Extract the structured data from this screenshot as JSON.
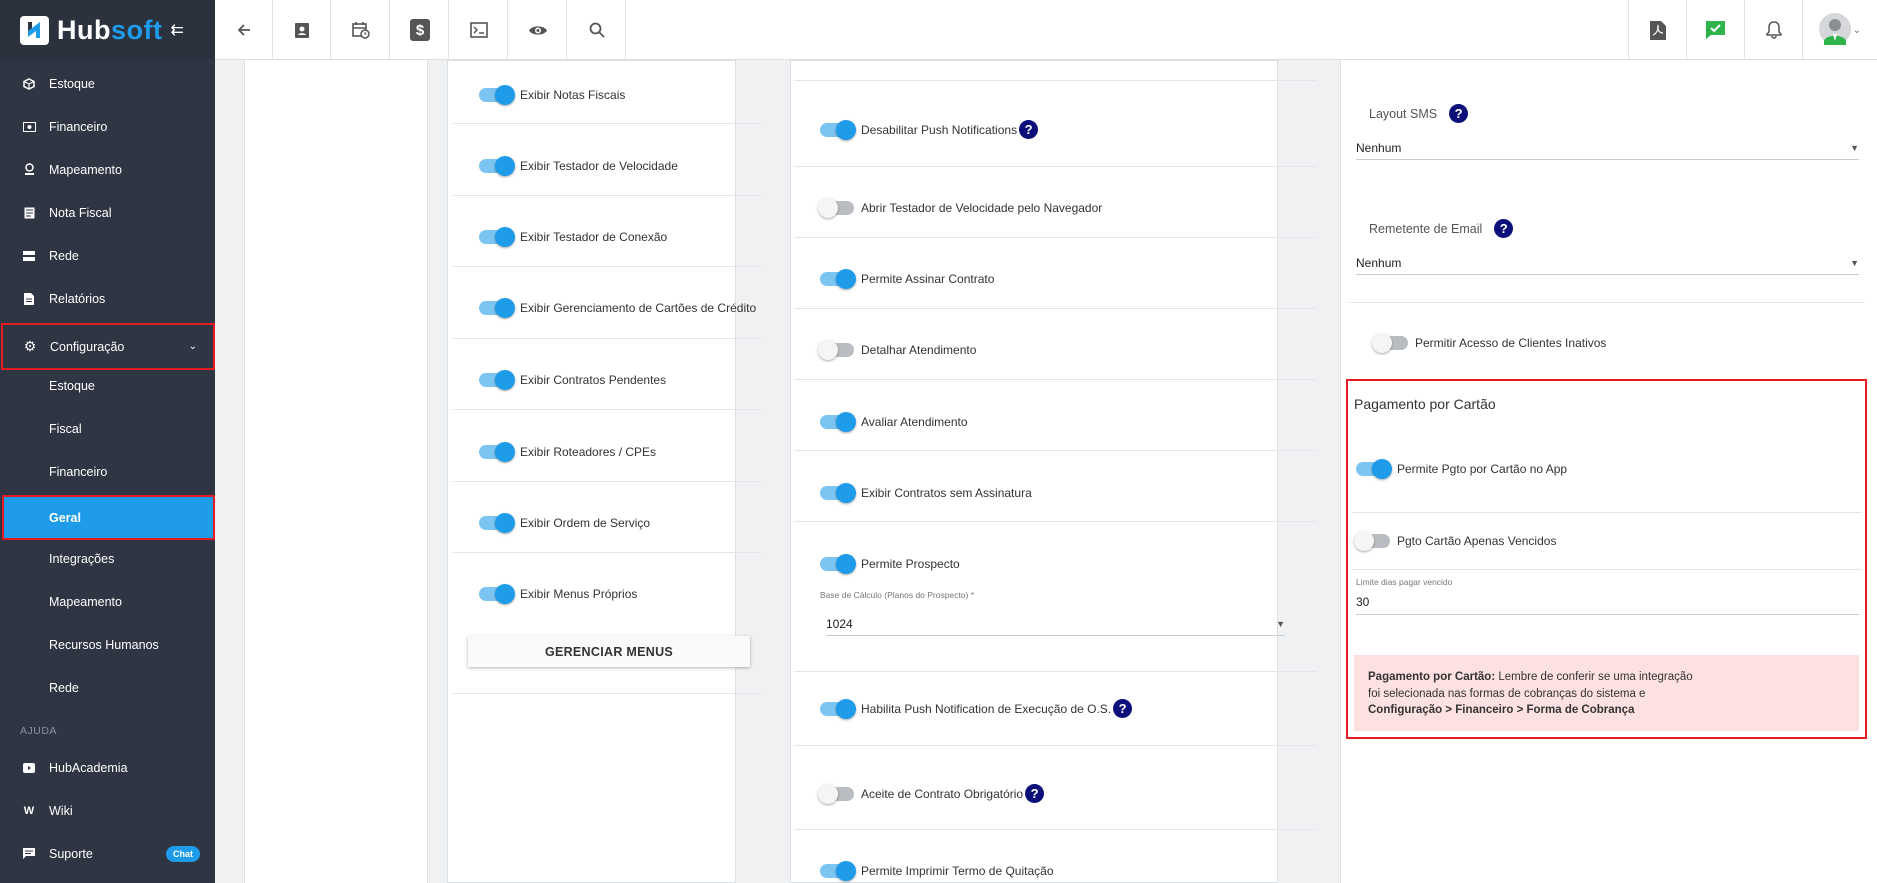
{
  "brand": {
    "name_part1": "Hub",
    "name_part2": "soft"
  },
  "sidebar": {
    "items": [
      {
        "label": "Estoque",
        "icon": "cube-icon"
      },
      {
        "label": "Financeiro",
        "icon": "money-icon"
      },
      {
        "label": "Mapeamento",
        "icon": "map-pin-icon"
      },
      {
        "label": "Nota Fiscal",
        "icon": "receipt-icon"
      },
      {
        "label": "Rede",
        "icon": "server-icon"
      },
      {
        "label": "Relatórios",
        "icon": "document-icon"
      },
      {
        "label": "Configuração",
        "icon": "gear-icon"
      }
    ],
    "sub_items": [
      "Estoque",
      "Fiscal",
      "Financeiro",
      "Geral",
      "Integrações",
      "Mapeamento",
      "Recursos Humanos",
      "Rede"
    ],
    "active_sub": "Geral",
    "help_section": "AJUDA",
    "help_items": [
      {
        "label": "HubAcademia",
        "icon": "youtube-icon"
      },
      {
        "label": "Wiki",
        "icon": "wikipedia-icon"
      },
      {
        "label": "Suporte",
        "icon": "chat-icon",
        "badge": "Chat"
      }
    ]
  },
  "topbar": {
    "left_icons": [
      "back-arrow-icon",
      "contact-card-icon",
      "calendar-clock-icon",
      "dollar-icon",
      "terminal-icon",
      "eye-icon",
      "search-icon"
    ],
    "right_icons": [
      "pdf-icon",
      "chat-check-icon",
      "bell-icon",
      "user-avatar-icon"
    ]
  },
  "col1": {
    "toggles": [
      {
        "label": "Exibir Notas Fiscais",
        "on": true
      },
      {
        "label": "Exibir Testador de Velocidade",
        "on": true
      },
      {
        "label": "Exibir Testador de Conexão",
        "on": true
      },
      {
        "label": "Exibir Gerenciamento de Cartões de Crédito",
        "on": true
      },
      {
        "label": "Exibir Contratos Pendentes",
        "on": true
      },
      {
        "label": "Exibir Roteadores / CPEs",
        "on": true
      },
      {
        "label": "Exibir Ordem de Serviço",
        "on": true
      },
      {
        "label": "Exibir Menus Próprios",
        "on": true
      }
    ],
    "button": "GERENCIAR MENUS"
  },
  "col2": {
    "toggles": [
      {
        "label": "Desabilitar Push Notifications",
        "on": true,
        "help": true
      },
      {
        "label": "Abrir Testador de Velocidade pelo Navegador",
        "on": false
      },
      {
        "label": "Permite Assinar Contrato",
        "on": true
      },
      {
        "label": "Detalhar Atendimento",
        "on": false
      },
      {
        "label": "Avaliar Atendimento",
        "on": true
      },
      {
        "label": "Exibir Contratos sem Assinatura",
        "on": true
      },
      {
        "label": "Permite Prospecto",
        "on": true
      },
      {
        "label": "Habilita Push Notification de Execução de O.S.",
        "on": true,
        "help": true
      },
      {
        "label": "Aceite de Contrato Obrigatório",
        "on": false,
        "help": true
      },
      {
        "label": "Permite Imprimir Termo de Quitação",
        "on": true
      }
    ],
    "base_calculo": {
      "label": "Base de Cálculo (Planos do Prospecto) *",
      "value": "1024"
    }
  },
  "col3": {
    "layout_sms": {
      "label": "Layout SMS",
      "value": "Nenhum"
    },
    "remetente_email": {
      "label": "Remetente de Email",
      "value": "Nenhum"
    },
    "inativos": {
      "label": "Permitir Acesso de Clientes Inativos",
      "on": false
    },
    "card": {
      "title": "Pagamento por Cartão",
      "toggle1": {
        "label": "Permite Pgto por Cartão no App",
        "on": true
      },
      "toggle2": {
        "label": "Pgto Cartão Apenas Vencidos",
        "on": false
      },
      "limite": {
        "label": "Limite dias pagar vencido",
        "value": "30"
      },
      "alert": {
        "bold": "Pagamento por Cartão:",
        "text1": " Lembre de conferir se uma integração",
        "text2": "foi selecionada nas formas de cobranças do sistema e",
        "path": "Configuração > Financeiro > Forma de Cobrança"
      }
    }
  },
  "colors": {
    "accent": "#1e9be9",
    "sidebar_bg": "#2f3542",
    "highlight": "#e41b23"
  }
}
